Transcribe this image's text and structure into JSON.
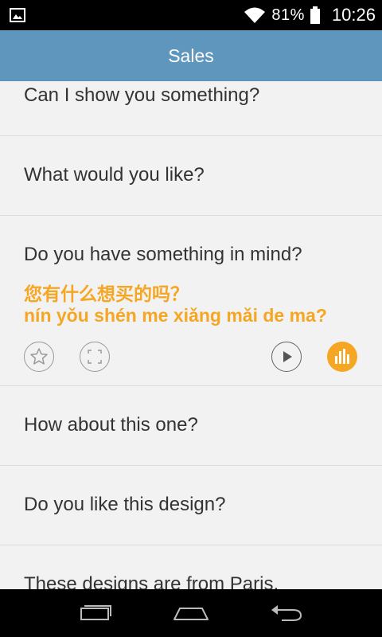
{
  "status_bar": {
    "left_icon": "gallery-icon",
    "wifi_icon": "wifi-icon",
    "battery_text": "81%",
    "battery_icon": "battery-icon",
    "time": "10:26"
  },
  "header": {
    "title": "Sales",
    "color": "#5e96bd"
  },
  "phrases": [
    {
      "english": "Can I show you something?"
    },
    {
      "english": "What would you like?"
    },
    {
      "english": "Do you have something in mind?",
      "chinese": "您有什么想买的吗？",
      "pinyin": "nín yǒu shén me xiǎng mǎi de ma?",
      "expanded": true,
      "actions": [
        "star-icon",
        "expand-icon",
        "play-icon",
        "audio-level-icon"
      ]
    },
    {
      "english": "How about this one?"
    },
    {
      "english": "Do you like this design?"
    },
    {
      "english": "These designs are from Paris."
    }
  ],
  "accent_color": "#f5a623",
  "nav_bar": {
    "buttons": [
      "recent-apps-icon",
      "home-icon",
      "back-icon"
    ]
  }
}
